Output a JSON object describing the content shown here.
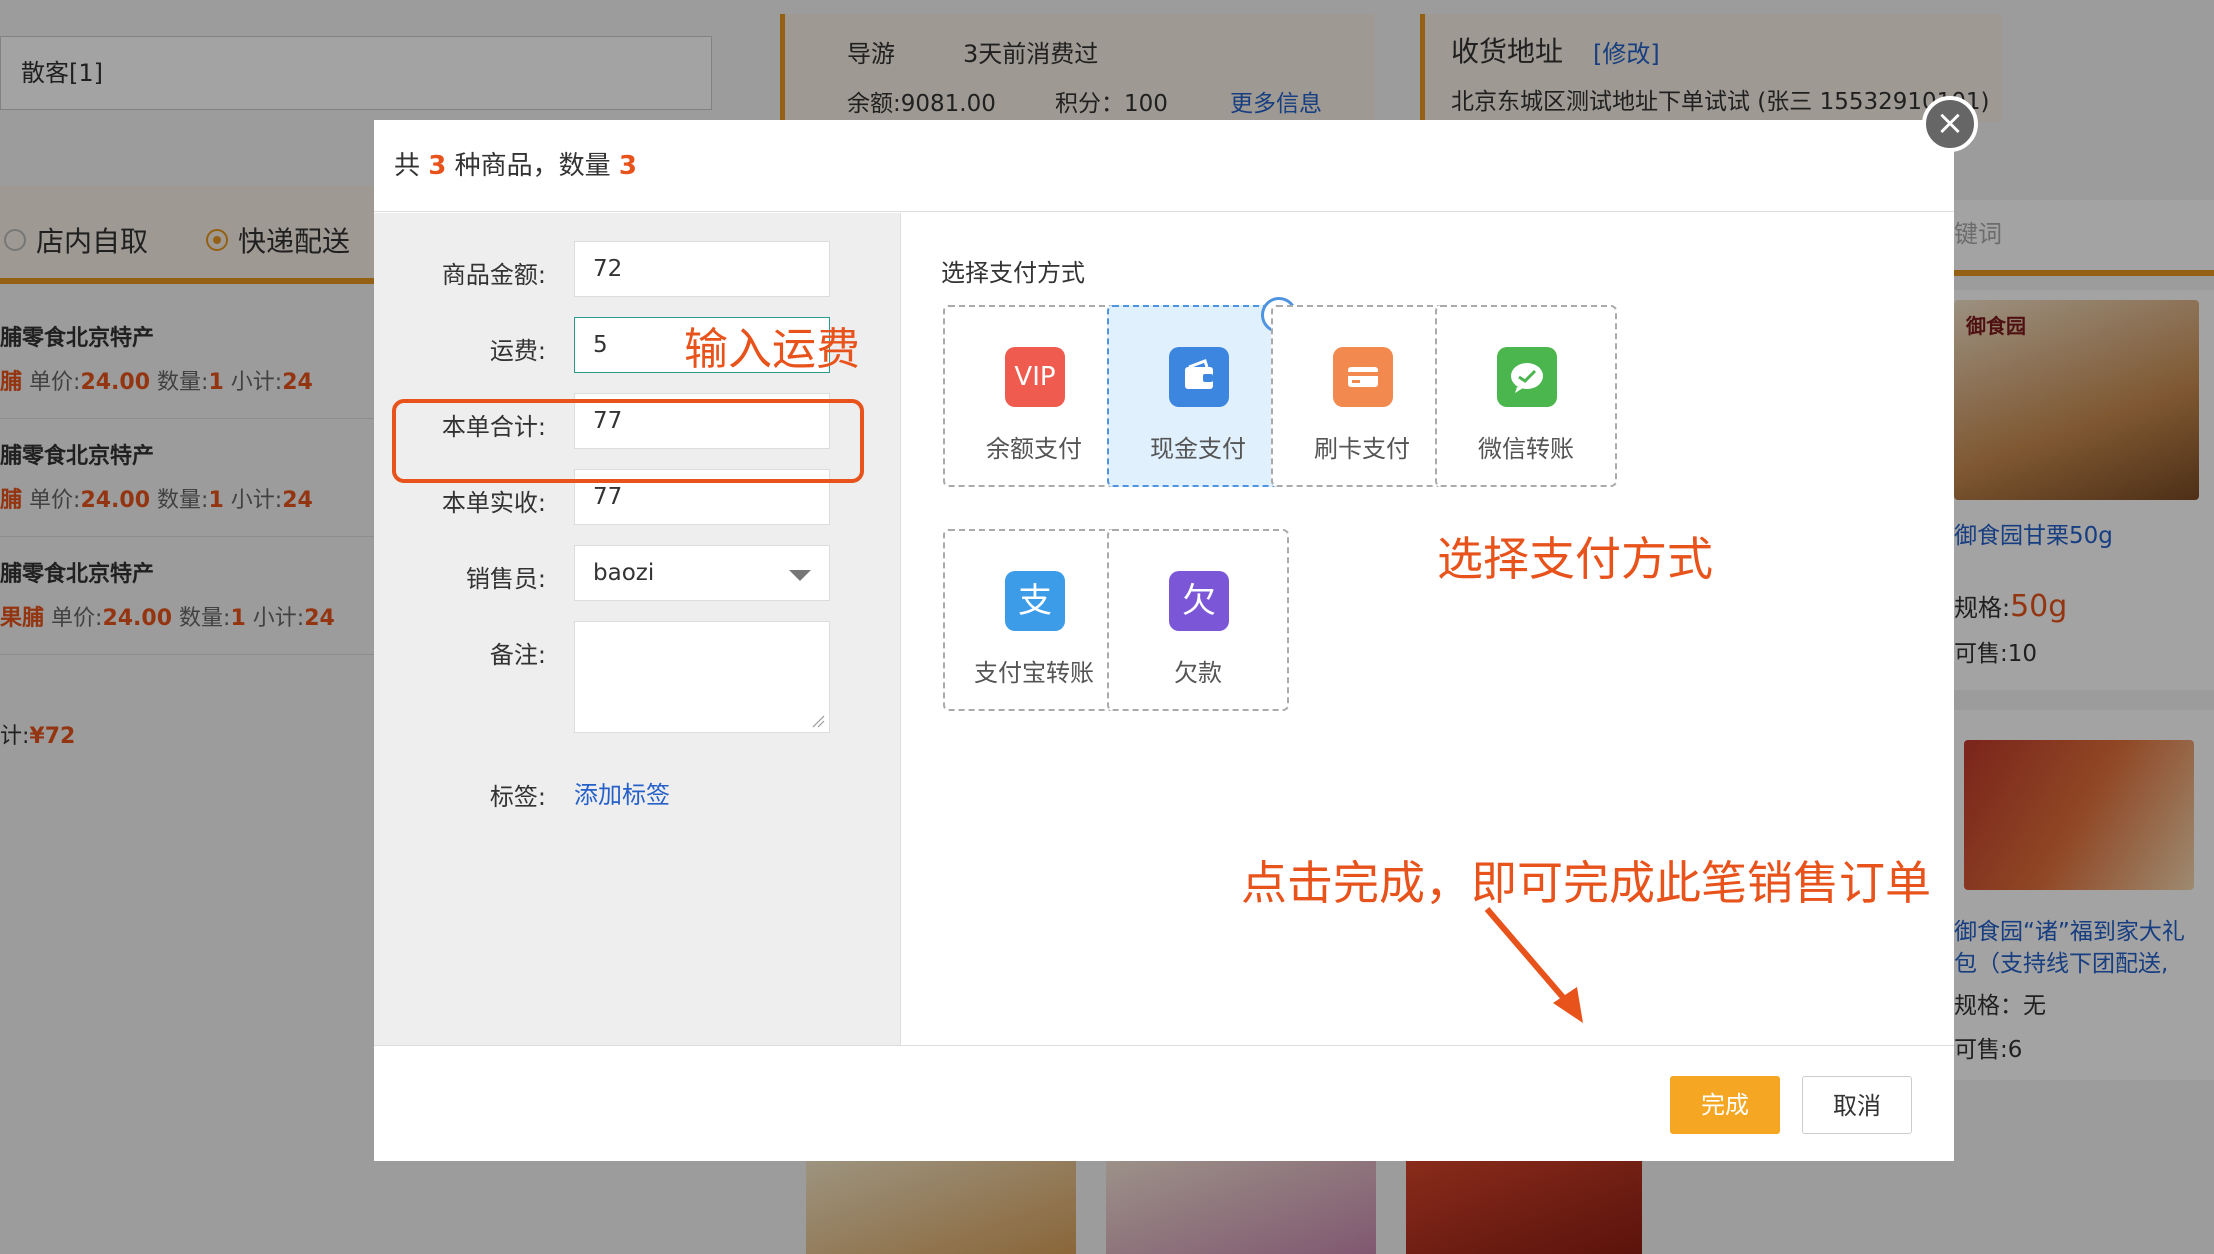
{
  "background": {
    "customer": "散客[1]",
    "guide_card": {
      "label": "导游",
      "last_visit": "3天前消费过",
      "balance": "余额:9081.00",
      "points": "积分：100",
      "more": "更多信息"
    },
    "address_card": {
      "title": "收货地址",
      "edit": "[修改]",
      "address": "北京东城区测试地址下单试试 (张三 15532910101)"
    },
    "delivery": {
      "pickup": "店内自取",
      "express": "快递配送"
    },
    "cart_items": [
      {
        "name": "脯零食北京特产",
        "prefix": "脯",
        "price_label": "单价:",
        "price": "24.00",
        "qty_label": "数量:",
        "qty": "1",
        "sub_label": "小计:",
        "sub": "24"
      },
      {
        "name": "脯零食北京特产",
        "prefix": "脯",
        "price_label": "单价:",
        "price": "24.00",
        "qty_label": "数量:",
        "qty": "1",
        "sub_label": "小计:",
        "sub": "24"
      },
      {
        "name": "脯零食北京特产",
        "prefix": "果脯",
        "price_label": "单价:",
        "price": "24.00",
        "qty_label": "数量:",
        "qty": "1",
        "sub_label": "小计:",
        "sub": "24"
      }
    ],
    "total": {
      "label": "计:",
      "value": "¥72"
    },
    "search_hint": "键词",
    "products": [
      {
        "logo": "御食园",
        "name": "御食园甘栗50g",
        "spec_label": "规格:",
        "spec": "50g",
        "stock": "可售:10"
      },
      {
        "name1": "御食园“诸”福到家大礼",
        "name2": "包（支持线下团配送,",
        "spec": "规格：无",
        "stock": "可售:6"
      }
    ]
  },
  "modal": {
    "header": {
      "prefix": "共 ",
      "kinds": "3",
      "mid": " 种商品，数量 ",
      "qty": "3"
    },
    "fields": {
      "goods_amount": {
        "label": "商品金额:",
        "value": "72"
      },
      "shipping": {
        "label": "运费:",
        "value": "5"
      },
      "order_total": {
        "label": "本单合计:",
        "value": "77"
      },
      "order_received": {
        "label": "本单实收:",
        "value": "77"
      },
      "salesperson": {
        "label": "销售员:",
        "value": "baozi"
      },
      "remark": {
        "label": "备注:",
        "value": ""
      },
      "tag": {
        "label": "标签:",
        "link": "添加标签"
      }
    },
    "pay_title": "选择支付方式",
    "pay_methods": [
      {
        "label": "余额支付",
        "icon": "vip-icon",
        "icon_text": "VIP",
        "color": "#ef5b4f"
      },
      {
        "label": "现金支付",
        "icon": "wallet-icon",
        "color": "#3d86e0",
        "selected": true
      },
      {
        "label": "刷卡支付",
        "icon": "card-icon",
        "color": "#f2894e"
      },
      {
        "label": "微信转账",
        "icon": "wechat-icon",
        "color": "#4bb54e"
      },
      {
        "label": "支付宝转账",
        "icon": "alipay-icon",
        "icon_text": "支",
        "color": "#3c9ce8"
      },
      {
        "label": "欠款",
        "icon": "debt-icon",
        "icon_text": "欠",
        "color": "#7b56d6"
      }
    ],
    "buttons": {
      "done": "完成",
      "cancel": "取消"
    }
  },
  "annotations": {
    "shipping": "输入运费",
    "payment": "选择支付方式",
    "finish": "点击完成，即可完成此笔销售订单"
  }
}
